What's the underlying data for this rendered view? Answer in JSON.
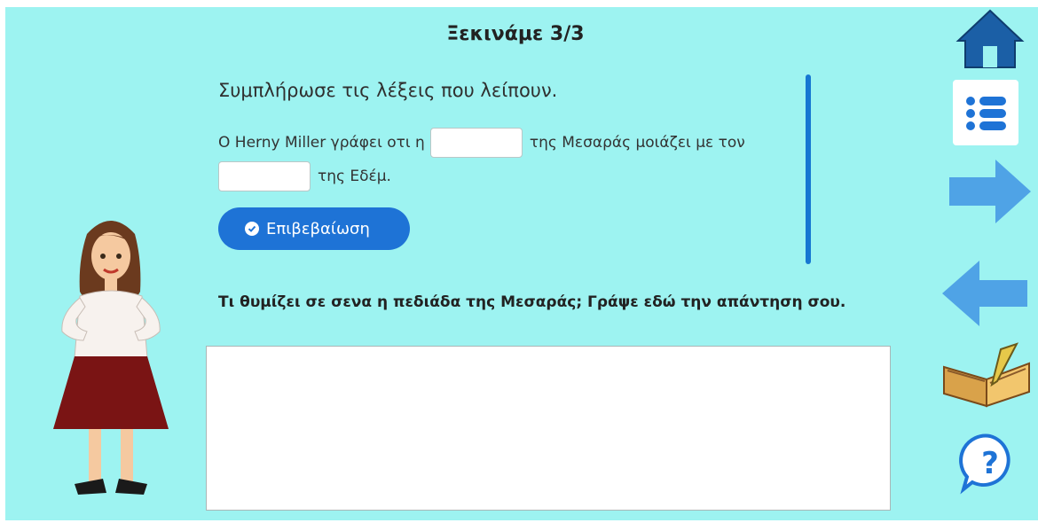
{
  "header": {
    "title": "Ξεκινάμε 3/3"
  },
  "exercise": {
    "instruction": "Συμπλήρωσε τις λέξεις που λείπουν.",
    "sentence_part1": "O Herny Miller γράφει οτι η",
    "sentence_part2": "της Μεσαράς μοιάζει με τον",
    "sentence_part3": "της Εδέμ.",
    "blank1_value": "",
    "blank2_value": "",
    "confirm_label": "Επιβεβαίωση"
  },
  "question": {
    "text": "Τι θυμίζει σε σενα η πεδιάδα της Μεσαράς; Γράψε εδώ την απάντηση σου.",
    "answer_value": ""
  },
  "nav": {
    "icons": [
      "home-icon",
      "menu-list-icon",
      "arrow-right-icon",
      "arrow-left-icon",
      "book-pen-icon",
      "help-icon"
    ],
    "colors": {
      "background": "#9df3f1",
      "primary": "#1e73d6",
      "arrow": "#4fa3e6"
    }
  }
}
